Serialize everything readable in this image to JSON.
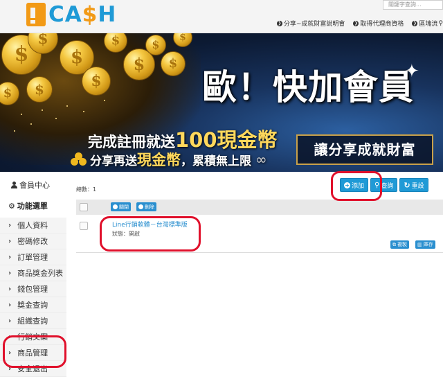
{
  "header": {
    "logo": {
      "mark": "icash-logo-mark",
      "text_part1": "CA",
      "text_part2": "$",
      "text_part3": "H"
    },
    "search_placeholder": "關鍵字查詢...",
    "nav": [
      "分享~成就財富說明會",
      "取得代理商資格",
      "區塊流"
    ]
  },
  "banner": {
    "headline": "歐！快加會員",
    "line1_prefix": "完成註冊就送",
    "line1_highlight": "100現金幣",
    "line2_prefix": "分享再送",
    "line2_highlight": "現金幣",
    "line2_suffix": "，累積無上限",
    "infinity": "∞",
    "slogan": "讓分享成就財富",
    "coin_symbol": "$"
  },
  "sidebar": {
    "member_center": "會員中心",
    "menu_title": "功能選單",
    "items": [
      {
        "label": "個人資料"
      },
      {
        "label": "密碼修改"
      },
      {
        "label": "訂單管理"
      },
      {
        "label": "商品獎金列表"
      },
      {
        "label": "錢包管理"
      },
      {
        "label": "獎金查詢"
      },
      {
        "label": "組織查詢"
      },
      {
        "label": "行銷文案"
      },
      {
        "label": "商品管理"
      },
      {
        "label": "安全退出"
      }
    ]
  },
  "main": {
    "total": "總數：1",
    "buttons": {
      "add": "添加",
      "query": "查詢",
      "reset": "重設"
    },
    "table_actions": {
      "close": "關閉",
      "delete": "刪除"
    },
    "rows": [
      {
        "title": "Line行銷軟體－台灣標準版",
        "status": "狀態：開啟",
        "copy": "複製",
        "inventory": "庫存"
      }
    ]
  },
  "colors": {
    "accent": "#1f9ad6",
    "brand_orange": "#f29a16",
    "annotation_red": "#e0102b"
  }
}
